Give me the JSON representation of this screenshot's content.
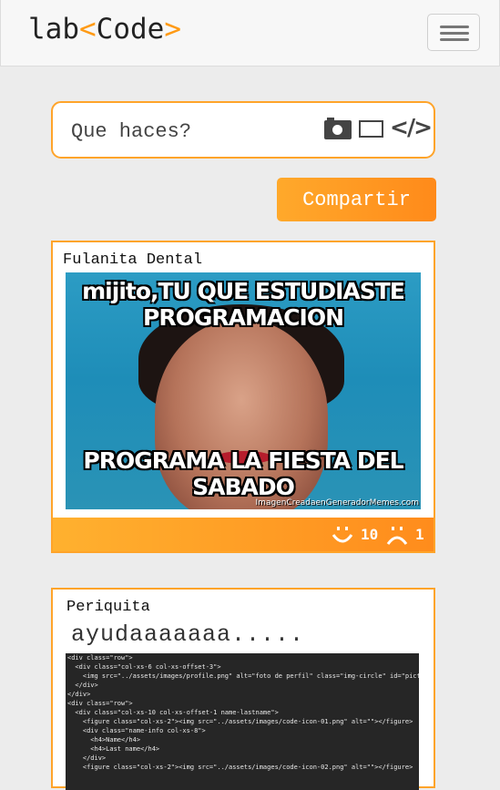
{
  "navbar": {
    "brand": {
      "part1": "lab",
      "lt": "<",
      "part2": "Code",
      "gt": ">"
    }
  },
  "composer": {
    "placeholder": "Que haces?",
    "icons": [
      "camera-icon",
      "video-icon",
      "code-icon"
    ]
  },
  "share_button": {
    "label": "Compartir"
  },
  "posts": [
    {
      "author": "Fulanita Dental",
      "image": {
        "top_caption": "mijito,TU QUE ESTUDIASTE PROGRAMACION",
        "bottom_caption": "PROGRAMA LA FIESTA DEL SABADO",
        "watermark": "ImagenCreadaenGeneradorMemes.com"
      },
      "likes": "10",
      "dislikes": "1"
    },
    {
      "author": "Periquita",
      "text": "ayudaaaaaaa.....",
      "code_lines": [
        "<div class=\"row\">",
        "  <div class=\"col-xs-6 col-xs-offset-3\">",
        "    <img src=\"../assets/images/profile.png\" alt=\"foto de perfil\" class=\"img-circle\" id=\"pictu",
        "  </div>",
        "</div>",
        "<div class=\"row\">",
        "  <div class=\"col-xs-10 col-xs-offset-1 name-lastname\">",
        "    <figure class=\"col-xs-2\"><img src=\"../assets/images/code-icon-01.png\" alt=\"\"></figure>",
        "    <div class=\"name-info col-xs-8\">",
        "      <h4>Name</h4>",
        "      <h4>Last name</h4>",
        "    </div>",
        "    <figure class=\"col-xs-2\"><img src=\"../assets/images/code-icon-02.png\" alt=\"\"></figure>"
      ]
    }
  ],
  "colors": {
    "accent": "#ffa42a",
    "accent_dark": "#ff8a1a"
  }
}
